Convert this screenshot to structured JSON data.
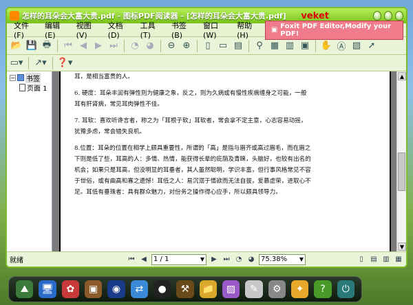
{
  "window": {
    "title": "怎样的耳朵会大富大贵.pdf - 图标PDF阅读器 - [怎样的耳朵会大富大贵.pdf]",
    "brand": "veket"
  },
  "menu": {
    "items": [
      "文件(F)",
      "编辑(E)",
      "视图(V)",
      "文档(D)",
      "工具(T)",
      "书签(B)",
      "窗口(W)",
      "帮助(H)"
    ],
    "ad_text": "Foxit PDF Editor,Modify your PDF!"
  },
  "sidebar": {
    "root_label": "书签",
    "page_label": "页面 1"
  },
  "document": {
    "lines": [
      "耳，是相当富贵的人。",
      "6. 硬度：耳朵丰润有弹性则为健康之象，反之，则为久病或有慢性疾病缠身之可能，一般",
      "耳有肝肾病，常见耳肉弹性不佳。",
      "7. 耳软：喜欢听谗言者，称之为「耳根子软」耳软者，常会拿不定主意，心志容易动摇，",
      "犹豫多虑，常会错失良机。",
      "8.位置：耳朵的位置在相学上颇具重要性，所谓的「高」是指与眉齐或高过眉毛，而在眉之",
      "下则是低了些，耳高的人：多情、热情，能获得长辈的庇荫及青睐，头脑好，也较有出名的",
      "机会；如果只是耳高，但没明显的耳垂者，其人虽然聪明，学识丰富，但行事风格常见不容",
      "于世俗，或有曲高和寡之遗憾！耳低之人：易沉溺于情欲而无法自拔，爱慕虚荣，进取心不",
      "足。耳低有垂珠者：具有群众魅力，对份务之操作得心应手，所以颇具领导力。"
    ]
  },
  "status": {
    "ready": "就绪",
    "page_field": "1 / 1",
    "zoom": "75.38%"
  }
}
